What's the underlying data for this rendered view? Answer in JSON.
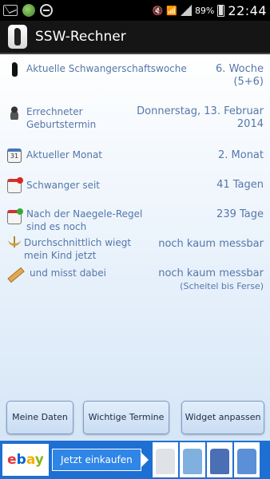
{
  "status_bar": {
    "battery": "89%",
    "time": "22:44"
  },
  "action_bar": {
    "title": "SSW-Rechner"
  },
  "rows": [
    {
      "label": "Aktuelle Schwangerschaftswoche",
      "value": "6. Woche",
      "value_sub": "(5+6)",
      "icon": "pregnant-woman-icon"
    },
    {
      "label": "Errechneter Geburtstermin",
      "value": "Donnerstag, 13. Februar 2014",
      "icon": "baby-icon"
    },
    {
      "label": "Aktueller Monat",
      "value": "2. Monat",
      "icon": "calendar-icon",
      "icon_text": "31"
    },
    {
      "label": "Schwanger seit",
      "value": "41 Tagen",
      "icon": "calendar-red-icon"
    },
    {
      "label": "Nach der Naegele-Regel sind es noch",
      "value": "239 Tage",
      "icon": "calendar-green-icon"
    },
    {
      "label": "Durchschnittlich wiegt mein Kind jetzt",
      "value": "noch kaum messbar",
      "icon": "scale-icon"
    },
    {
      "label": "und misst dabei",
      "value": "noch kaum messbar",
      "value_sub": "(Scheitel bis Ferse)",
      "icon": "ruler-icon"
    }
  ],
  "buttons": {
    "my_data": "Meine Daten",
    "important_dates": "Wichtige Termine",
    "widget": "Widget anpassen"
  },
  "ad": {
    "logo": "ebay",
    "cta": "Jetzt einkaufen"
  },
  "colors": {
    "label_text": "#5577aa",
    "button_border": "#7f9cc6",
    "ad_background": "#1d6fd3"
  }
}
